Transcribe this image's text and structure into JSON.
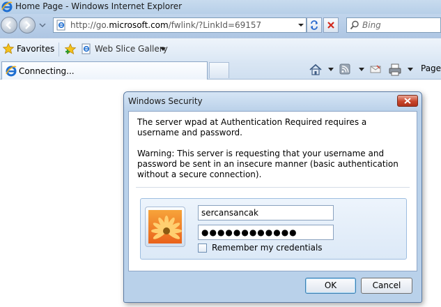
{
  "window": {
    "title": "Home Page - Windows Internet Explorer"
  },
  "navigation": {
    "address_url_prefix": "http://go.",
    "address_url_domain": "microsoft.com",
    "address_url_suffix": "/fwlink/?LinkId=69157",
    "search_placeholder": "Bing"
  },
  "favorites_bar": {
    "favorites_label": "Favorites",
    "web_slice_gallery_label": "Web Slice Gallery"
  },
  "tabs": [
    {
      "label": "Connecting..."
    }
  ],
  "command_bar": {
    "page_label": "Page"
  },
  "dialog": {
    "title": "Windows Security",
    "message": "The server wpad at Authentication Required requires a username and password.",
    "warning": "Warning: This server is requesting that your username and password be sent in an insecure manner (basic authentication without a secure connection).",
    "username_value": "sercansancak",
    "password_value": "●●●●●●●●●●●●",
    "remember_label": "Remember my credentials",
    "remember_checked": false,
    "ok_label": "OK",
    "cancel_label": "Cancel"
  },
  "colors": {
    "chrome_blue": "#b9d1ea",
    "close_red": "#c8452b"
  }
}
